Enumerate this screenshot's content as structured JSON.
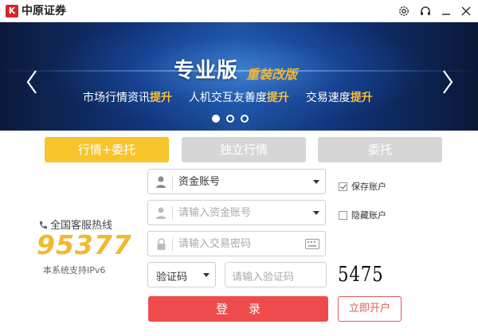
{
  "window": {
    "logo_text": "K",
    "title": "中原证券",
    "settings_icon": "gear-icon",
    "support_icon": "headset-icon",
    "minimize_icon": "minimize-icon",
    "close_icon": "close-icon"
  },
  "banner": {
    "title": "专业版",
    "subtitle": "重装改版",
    "slogans": [
      {
        "text": "市场行情资讯",
        "highlight": "提升"
      },
      {
        "text": "人机交互友善度",
        "highlight": "提升"
      },
      {
        "text": "交易速度",
        "highlight": "提升"
      }
    ],
    "slide_count": 3,
    "active_slide": 1
  },
  "tabs": [
    {
      "label": "行情+委托",
      "active": true
    },
    {
      "label": "独立行情",
      "active": false
    },
    {
      "label": "委托",
      "active": false
    }
  ],
  "hotline": {
    "label": "全国客服热线",
    "number": "95377",
    "ipv6_note": "本系统支持IPv6"
  },
  "form": {
    "account_type": "资金账号",
    "account_placeholder": "请输入资金账号",
    "password_placeholder": "请输入交易密码",
    "captcha_type": "验证码",
    "captcha_placeholder": "请输入验证码",
    "captcha_code": "5475",
    "save_account_label": "保存账户",
    "save_account_checked": true,
    "hide_account_label": "隐藏账户",
    "hide_account_checked": false,
    "login_label": "登录",
    "open_account_label": "立即开户"
  },
  "colors": {
    "accent_yellow": "#f7c42a",
    "login_red": "#ee4c4c",
    "highlight_gold": "#f7c13a",
    "tab_inactive": "#d6d6d6"
  }
}
